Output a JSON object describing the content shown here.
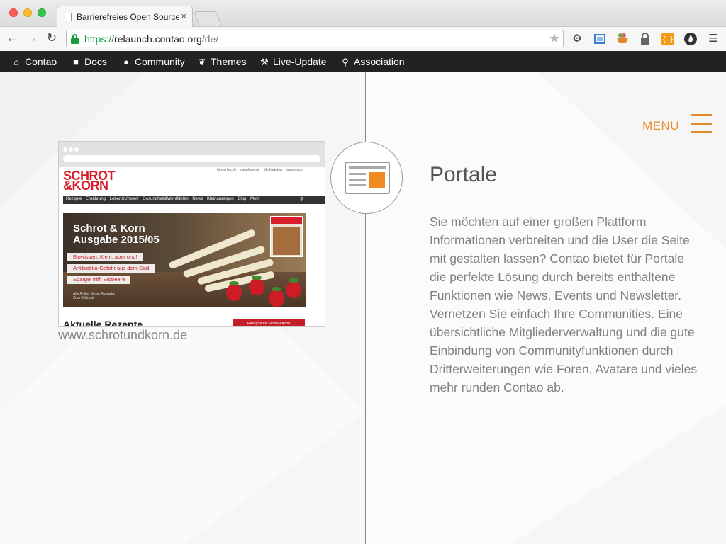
{
  "browser": {
    "tab_title": "Barrierefreies Open Source",
    "tab_close": "×",
    "url_protocol": "https://",
    "url_host": "relaunch.contao.org",
    "url_path": "/de/",
    "icons": [
      "back-arrow-icon",
      "forward-arrow-icon",
      "reload-icon",
      "lock-icon",
      "star-icon",
      "gear-icon",
      "screen-capture-icon",
      "basket-icon",
      "padlock-icon",
      "code-icon",
      "flame-icon",
      "hamburger-menu-icon"
    ]
  },
  "sitenav": {
    "items": [
      {
        "label": "Contao",
        "icon": "home-icon"
      },
      {
        "label": "Docs",
        "icon": "book-icon"
      },
      {
        "label": "Community",
        "icon": "user-icon"
      },
      {
        "label": "Themes",
        "icon": "leaf-icon"
      },
      {
        "label": "Live-Update",
        "icon": "wrench-icon"
      },
      {
        "label": "Association",
        "icon": "map-pin-icon"
      }
    ]
  },
  "menu": {
    "label": "MENU",
    "accent": "#e98b2a"
  },
  "section": {
    "heading": "Portale",
    "body": "Sie möchten auf einer großen Plattform Informationen verbreiten und die User die Seite mit gestalten lassen? Contao bietet für Portale die perfekte Lösung durch bereits enthaltene Funktionen wie News, Events und Newsletter. Vernetzen Sie einfach Ihre Communities. Eine übersichtliche Mitgliederverwaltung und die gute Einbindung von Communityfunktionen durch Dritterweiterungen wie Foren, Avatare und vieles mehr runden Contao ab."
  },
  "showcase": {
    "caption": "www.schrotundkorn.de",
    "logo_line1": "SCHROT",
    "logo_line2": "&KORN",
    "toplinks": "bioverlag.de naturkost.de Mediadaten Impressum",
    "nav": "Rezepte Ernährung Leben&Umwelt Gesundheit&Wohlfühlen News Kleinanzeigen Blog Mehr",
    "hero_title_1": "Schrot & Korn",
    "hero_title_2": "Ausgabe 2015/05",
    "pills": [
      "Biowissen: Klein, aber oho!",
      "Antibiotika-Gefahr aus dem Stall",
      "Spargel trifft Erdbeere"
    ],
    "hero_small_1": "Alle Artikel dieser Ausgabe",
    "hero_small_2": "Zum Editorial",
    "section_title": "Aktuelle Rezepte",
    "button": "Hier gibt es Schrot&Korn"
  }
}
